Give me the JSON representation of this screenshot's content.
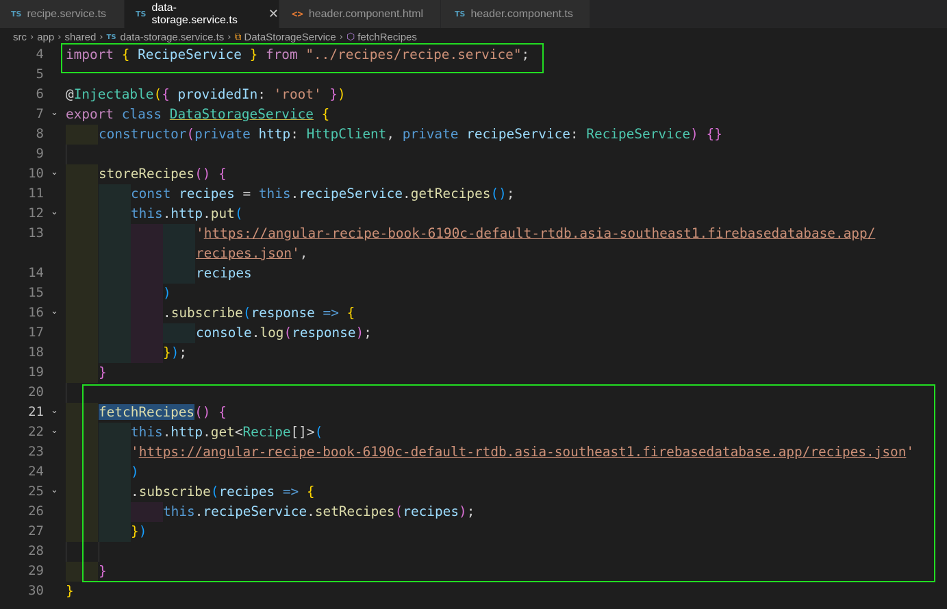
{
  "tabs": [
    {
      "icon": "TS",
      "label": "recipe.service.ts",
      "active": false
    },
    {
      "icon": "TS",
      "label": "data-storage.service.ts",
      "active": true
    },
    {
      "icon": "<>",
      "label": "header.component.html",
      "active": false
    },
    {
      "icon": "TS",
      "label": "header.component.ts",
      "active": false
    }
  ],
  "breadcrumb": {
    "src": "src",
    "app": "app",
    "shared": "shared",
    "file_icon": "TS",
    "file": "data-storage.service.ts",
    "class": "DataStorageService",
    "method": "fetchRecipes"
  },
  "lines": {
    "n4": "4",
    "n5": "5",
    "n6": "6",
    "n7": "7",
    "n8": "8",
    "n9": "9",
    "n10": "10",
    "n11": "11",
    "n12": "12",
    "n13": "13",
    "n14": "14",
    "n15": "15",
    "n16": "16",
    "n17": "17",
    "n18": "18",
    "n19": "19",
    "n20": "20",
    "n21": "21",
    "n22": "22",
    "n23": "23",
    "n24": "24",
    "n25": "25",
    "n26": "26",
    "n27": "27",
    "n28": "28",
    "n29": "29",
    "n30": "30"
  },
  "code": {
    "l4": {
      "import": "import",
      "ob": "{",
      "name": "RecipeService",
      "cb": "}",
      "from": "from",
      "path": "\"../recipes/recipe.service\"",
      "semi": ";"
    },
    "l6": {
      "at": "@",
      "dec": "Injectable",
      "p1": "(",
      "ob": "{",
      "key": "providedIn",
      "colon": ":",
      "val": "'root'",
      "cb": "}",
      "p2": ")"
    },
    "l7": {
      "export": "export",
      "class": "class",
      "name": "DataStorageService",
      "ob": "{"
    },
    "l8": {
      "ctor": "constructor",
      "p1": "(",
      "priv1": "private",
      "http": "http",
      "c1": ":",
      "t1": "HttpClient",
      "comma": ",",
      "priv2": "private",
      "rs": "recipeService",
      "c2": ":",
      "t2": "RecipeService",
      "p2": ")",
      "body": "{}"
    },
    "l10": {
      "fn": "storeRecipes",
      "paren": "()",
      "ob": "{"
    },
    "l11": {
      "const": "const",
      "var": "recipes",
      "eq": "=",
      "this": "this",
      "dot1": ".",
      "rs": "recipeService",
      "dot2": ".",
      "fn": "getRecipes",
      "paren": "()",
      "semi": ";"
    },
    "l12": {
      "this": "this",
      "dot1": ".",
      "http": "http",
      "dot2": ".",
      "fn": "put",
      "p1": "("
    },
    "l13": {
      "q": "'",
      "url": "https://angular-recipe-book-6190c-default-rtdb.asia-southeast1.firebasedatabase.app/"
    },
    "l13b": {
      "url2": "recipes.json",
      "q": "'",
      "comma": ","
    },
    "l14": {
      "arg": "recipes"
    },
    "l15": {
      "p": ")"
    },
    "l16": {
      "dot": ".",
      "fn": "subscribe",
      "p1": "(",
      "arg": "response",
      "arrow": "=>",
      "ob": "{"
    },
    "l17": {
      "obj": "console",
      "dot": ".",
      "fn": "log",
      "p1": "(",
      "arg": "response",
      "p2": ")",
      "semi": ";"
    },
    "l18": {
      "cb": "}",
      "p": ")",
      "semi": ";"
    },
    "l19": {
      "cb": "}"
    },
    "l21": {
      "fn": "fetchRecipes",
      "paren": "()",
      "ob": "{"
    },
    "l22": {
      "this": "this",
      "dot1": ".",
      "http": "http",
      "dot2": ".",
      "fn": "get",
      "lt": "<",
      "type": "Recipe",
      "arr": "[]",
      "gt": ">",
      "p1": "("
    },
    "l23": {
      "q1": "'",
      "url": "https://angular-recipe-book-6190c-default-rtdb.asia-southeast1.firebasedatabase.app/recipes.json",
      "q2": "'"
    },
    "l24": {
      "p": ")"
    },
    "l25": {
      "dot": ".",
      "fn": "subscribe",
      "p1": "(",
      "arg": "recipes",
      "arrow": "=>",
      "ob": "{"
    },
    "l26": {
      "this": "this",
      "dot1": ".",
      "rs": "recipeService",
      "dot2": ".",
      "fn": "setRecipes",
      "p1": "(",
      "arg": "recipes",
      "p2": ")",
      "semi": ";"
    },
    "l27": {
      "cb": "}",
      "p": ")"
    },
    "l29": {
      "cb": "}"
    },
    "l30": {
      "cb": "}"
    }
  },
  "colors": {
    "highlight_box": "#22dd22",
    "keyword": "#569cd6",
    "import": "#c586c0",
    "type": "#4ec9b0",
    "variable": "#9cdcfe",
    "function": "#dcdcaa",
    "string": "#ce9178"
  }
}
